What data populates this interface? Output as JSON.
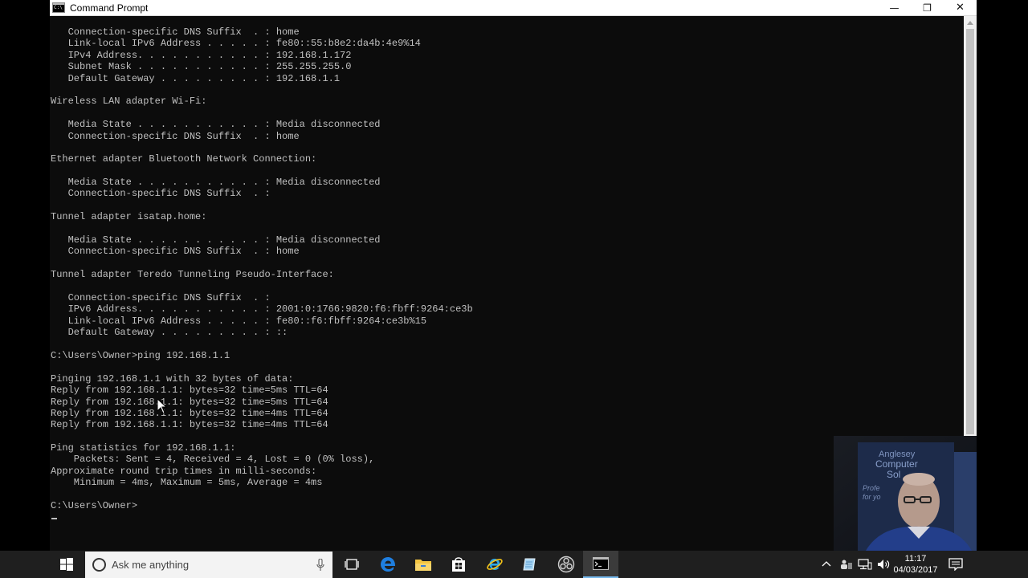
{
  "window": {
    "title": "Command Prompt",
    "minimize_glyph": "—",
    "restore_glyph": "❐",
    "close_glyph": "✕"
  },
  "console": {
    "lines": [
      "   Connection-specific DNS Suffix  . : home",
      "   Link-local IPv6 Address . . . . . : fe80::55:b8e2:da4b:4e9%14",
      "   IPv4 Address. . . . . . . . . . . : 192.168.1.172",
      "   Subnet Mask . . . . . . . . . . . : 255.255.255.0",
      "   Default Gateway . . . . . . . . . : 192.168.1.1",
      "",
      "Wireless LAN adapter Wi-Fi:",
      "",
      "   Media State . . . . . . . . . . . : Media disconnected",
      "   Connection-specific DNS Suffix  . : home",
      "",
      "Ethernet adapter Bluetooth Network Connection:",
      "",
      "   Media State . . . . . . . . . . . : Media disconnected",
      "   Connection-specific DNS Suffix  . :",
      "",
      "Tunnel adapter isatap.home:",
      "",
      "   Media State . . . . . . . . . . . : Media disconnected",
      "   Connection-specific DNS Suffix  . : home",
      "",
      "Tunnel adapter Teredo Tunneling Pseudo-Interface:",
      "",
      "   Connection-specific DNS Suffix  . :",
      "   IPv6 Address. . . . . . . . . . . : 2001:0:1766:9820:f6:fbff:9264:ce3b",
      "   Link-local IPv6 Address . . . . . : fe80::f6:fbff:9264:ce3b%15",
      "   Default Gateway . . . . . . . . . : ::",
      "",
      "C:\\Users\\Owner>ping 192.168.1.1",
      "",
      "Pinging 192.168.1.1 with 32 bytes of data:",
      "Reply from 192.168.1.1: bytes=32 time=5ms TTL=64",
      "Reply from 192.168.1.1: bytes=32 time=5ms TTL=64",
      "Reply from 192.168.1.1: bytes=32 time=4ms TTL=64",
      "Reply from 192.168.1.1: bytes=32 time=4ms TTL=64",
      "",
      "Ping statistics for 192.168.1.1:",
      "    Packets: Sent = 4, Received = 4, Lost = 0 (0% loss),",
      "Approximate round trip times in milli-seconds:",
      "    Minimum = 4ms, Maximum = 5ms, Average = 4ms",
      "",
      "C:\\Users\\Owner>"
    ],
    "text_color": "#c0c0c0",
    "background_color": "#0c0c0c"
  },
  "webcam": {
    "sign_lines": [
      "Anglesey",
      "Computer",
      "Sol"
    ],
    "sign_small_lines": [
      "Profe",
      "for yo"
    ]
  },
  "taskbar": {
    "search_placeholder": "Ask me anything",
    "icons": [
      "windows-start-icon",
      "task-view-icon",
      "edge-icon",
      "file-explorer-icon",
      "store-icon",
      "internet-explorer-icon",
      "notepad-icon",
      "obs-icon",
      "command-prompt-icon"
    ],
    "clock_time": "11:17",
    "clock_date": "04/03/2017",
    "accent_color": "#76b9ed"
  }
}
